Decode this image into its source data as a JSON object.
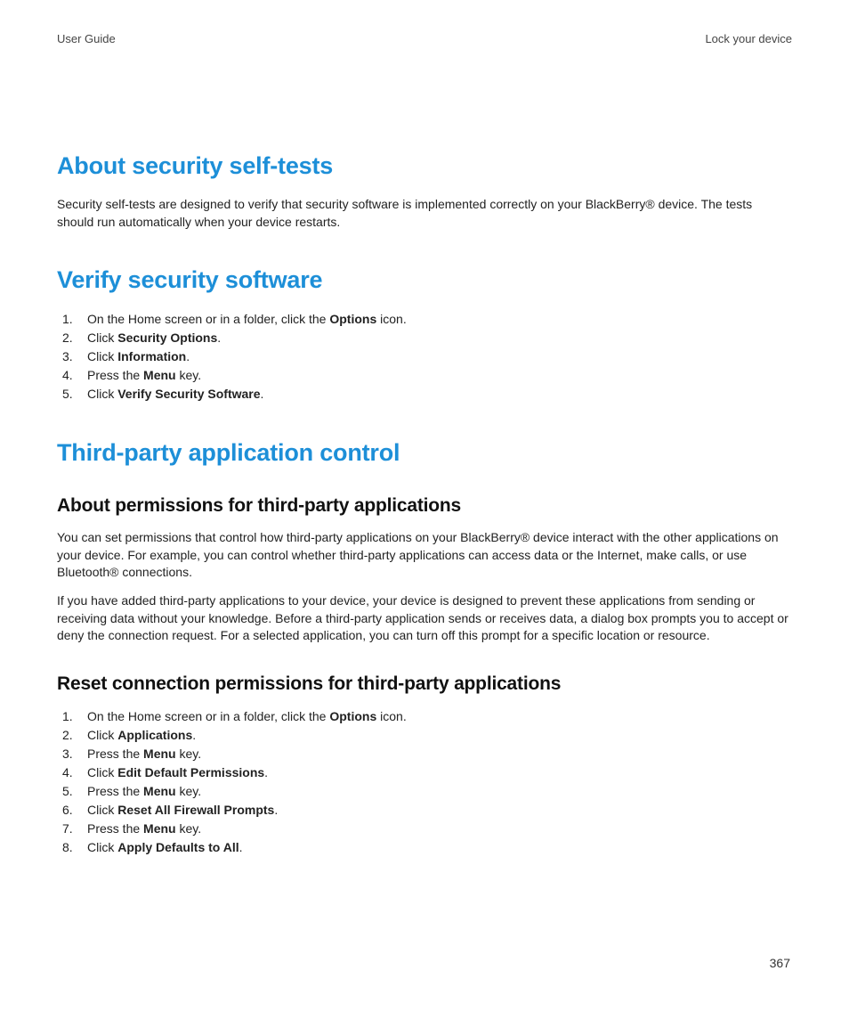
{
  "header": {
    "left": "User Guide",
    "right": "Lock your device"
  },
  "page_number": "367",
  "sections": {
    "s1": {
      "title": "About security self-tests",
      "para": "Security self-tests are designed to verify that security software is implemented correctly on your BlackBerry® device. The tests should run automatically when your device restarts."
    },
    "s2": {
      "title": "Verify security software",
      "steps": [
        {
          "pre": "On the Home screen or in a folder, click the ",
          "bold": "Options",
          "post": " icon."
        },
        {
          "pre": "Click ",
          "bold": "Security Options",
          "post": "."
        },
        {
          "pre": "Click ",
          "bold": "Information",
          "post": "."
        },
        {
          "pre": "Press the ",
          "bold": "Menu",
          "post": " key."
        },
        {
          "pre": "Click ",
          "bold": "Verify Security Software",
          "post": "."
        }
      ]
    },
    "s3": {
      "title": "Third-party application control",
      "sub1": {
        "title": "About permissions for third-party applications",
        "para1": "You can set permissions that control how third-party applications on your BlackBerry® device interact with the other applications on your device. For example, you can control whether third-party applications can access data or the Internet, make calls, or use Bluetooth® connections.",
        "para2": "If you have added third-party applications to your device, your device is designed to prevent these applications from sending or receiving data without your knowledge. Before a third-party application sends or receives data, a dialog box prompts you to accept or deny the connection request. For a selected application, you can turn off this prompt for a specific location or resource."
      },
      "sub2": {
        "title": "Reset connection permissions for third-party applications",
        "steps": [
          {
            "pre": "On the Home screen or in a folder, click the ",
            "bold": "Options",
            "post": " icon."
          },
          {
            "pre": "Click ",
            "bold": "Applications",
            "post": "."
          },
          {
            "pre": "Press the ",
            "bold": "Menu",
            "post": " key."
          },
          {
            "pre": "Click ",
            "bold": "Edit Default Permissions",
            "post": "."
          },
          {
            "pre": "Press the ",
            "bold": "Menu",
            "post": " key."
          },
          {
            "pre": "Click ",
            "bold": "Reset All Firewall Prompts",
            "post": "."
          },
          {
            "pre": "Press the ",
            "bold": "Menu",
            "post": " key."
          },
          {
            "pre": "Click ",
            "bold": "Apply Defaults to All",
            "post": "."
          }
        ]
      }
    }
  }
}
